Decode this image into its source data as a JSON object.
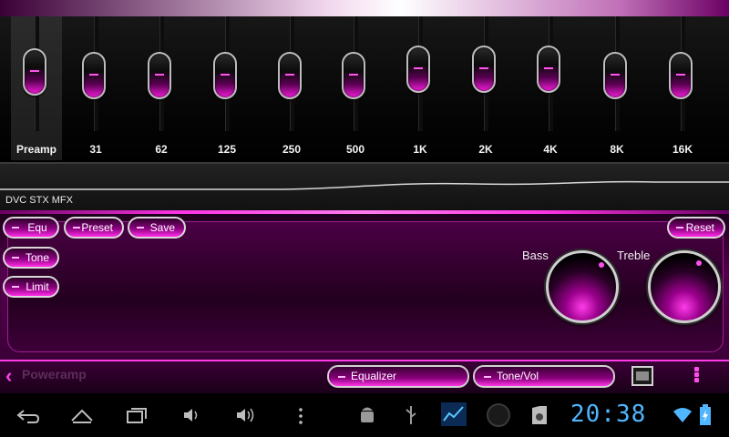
{
  "equalizer": {
    "bands": [
      {
        "label": "Preamp",
        "level": 0.55
      },
      {
        "label": "31",
        "level": 0.5
      },
      {
        "label": "62",
        "level": 0.5
      },
      {
        "label": "125",
        "level": 0.5
      },
      {
        "label": "250",
        "level": 0.5
      },
      {
        "label": "500",
        "level": 0.5
      },
      {
        "label": "1K",
        "level": 0.6
      },
      {
        "label": "2K",
        "level": 0.6
      },
      {
        "label": "4K",
        "level": 0.6
      },
      {
        "label": "8K",
        "level": 0.5
      },
      {
        "label": "16K",
        "level": 0.5
      }
    ]
  },
  "curve": {
    "label": "DVC STX MFX"
  },
  "controls": {
    "equ_label": "Equ",
    "tone_label": "Tone",
    "limit_label": "Limit",
    "preset_label": "Preset",
    "save_label": "Save",
    "reset_label": "Reset",
    "bass_label": "Bass",
    "treble_label": "Treble"
  },
  "bottom_bar": {
    "ghost_title": "Poweramp",
    "tab_equalizer": "Equalizer",
    "tab_tone": "Tone/Vol"
  },
  "system": {
    "clock": "20:38"
  },
  "colors": {
    "accent": "#ff2ce6",
    "clock": "#4fb6ff"
  }
}
